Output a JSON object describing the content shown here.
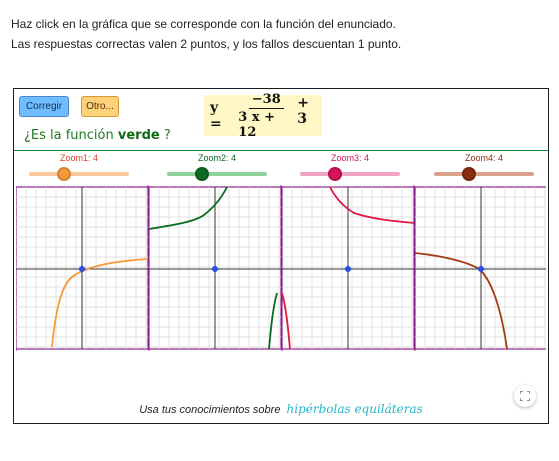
{
  "intro": {
    "line1": "Haz click en la gráfica que se corresponde con la función del enunciado.",
    "line2": "Las respuestas correctas valen 2 puntos, y los fallos descuentan 1 punto."
  },
  "buttons": {
    "corregir": "Corregir",
    "otro": "Otro..."
  },
  "formula": {
    "lhs": "y =",
    "numerator": "−38",
    "denominator": "3 x + 12",
    "rhs": "+ 3"
  },
  "question": {
    "prefix": "¿Es la función",
    "color_word": "verde",
    "suffix": "?"
  },
  "sliders": [
    {
      "label": "Zoom1: 4",
      "value": 4,
      "color": "#f59a3b",
      "track": "#f8c79a",
      "knob_fraction": 0.35
    },
    {
      "label": "Zoom2: 4",
      "value": 4,
      "color": "#0c6b22",
      "track": "#8fd19a",
      "knob_fraction": 0.35
    },
    {
      "label": "Zoom3: 4",
      "value": 4,
      "color": "#d4155a",
      "track": "#f0a3c3",
      "knob_fraction": 0.35
    },
    {
      "label": "Zoom4: 4",
      "value": 4,
      "color": "#8a2e10",
      "track": "#d9a08a",
      "knob_fraction": 0.35
    }
  ],
  "graph_colors": [
    "#f59a3b",
    "#0c6b22",
    "#e0173f",
    "#a13b12"
  ],
  "footer": {
    "text": "Usa tus conocimientos sobre",
    "accent": "hipérbolas equiláteras"
  },
  "icons": {
    "fullscreen": "fullscreen-icon"
  }
}
